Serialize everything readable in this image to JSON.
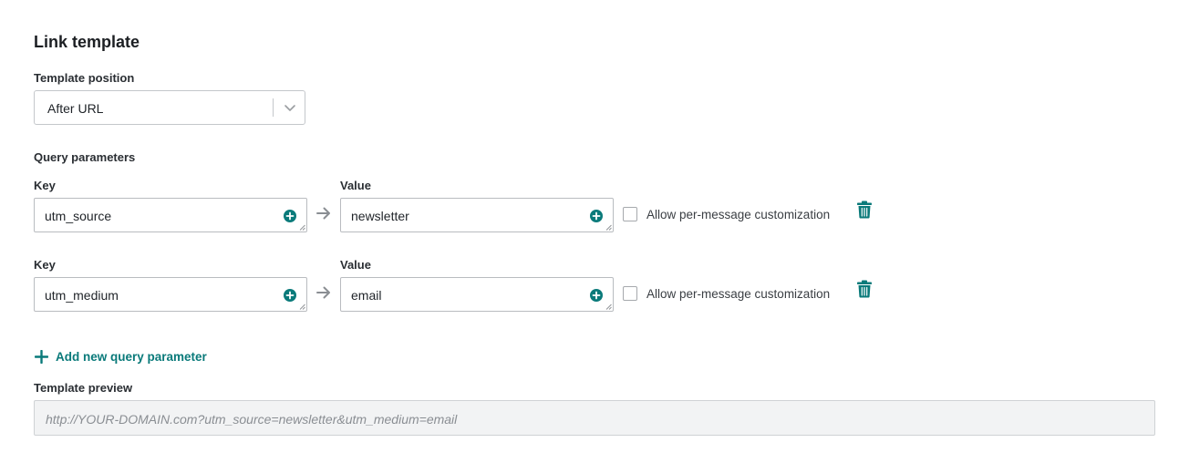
{
  "section_title": "Link template",
  "template_position": {
    "label": "Template position",
    "selected": "After URL"
  },
  "query_parameters": {
    "label": "Query parameters",
    "rows": [
      {
        "key_label": "Key",
        "key_value": "utm_source",
        "value_label": "Value",
        "value_value": "newsletter",
        "checkbox_label": "Allow per-message customization",
        "checked": false
      },
      {
        "key_label": "Key",
        "key_value": "utm_medium",
        "value_label": "Value",
        "value_value": "email",
        "checkbox_label": "Allow per-message customization",
        "checked": false
      }
    ]
  },
  "add_param_label": "Add new query parameter",
  "preview": {
    "label": "Template preview",
    "value": "http://YOUR-DOMAIN.com?utm_source=newsletter&utm_medium=email"
  },
  "colors": {
    "accent": "#0a7a7a",
    "border": "#b9bcc0",
    "preview_bg": "#f2f3f4"
  }
}
